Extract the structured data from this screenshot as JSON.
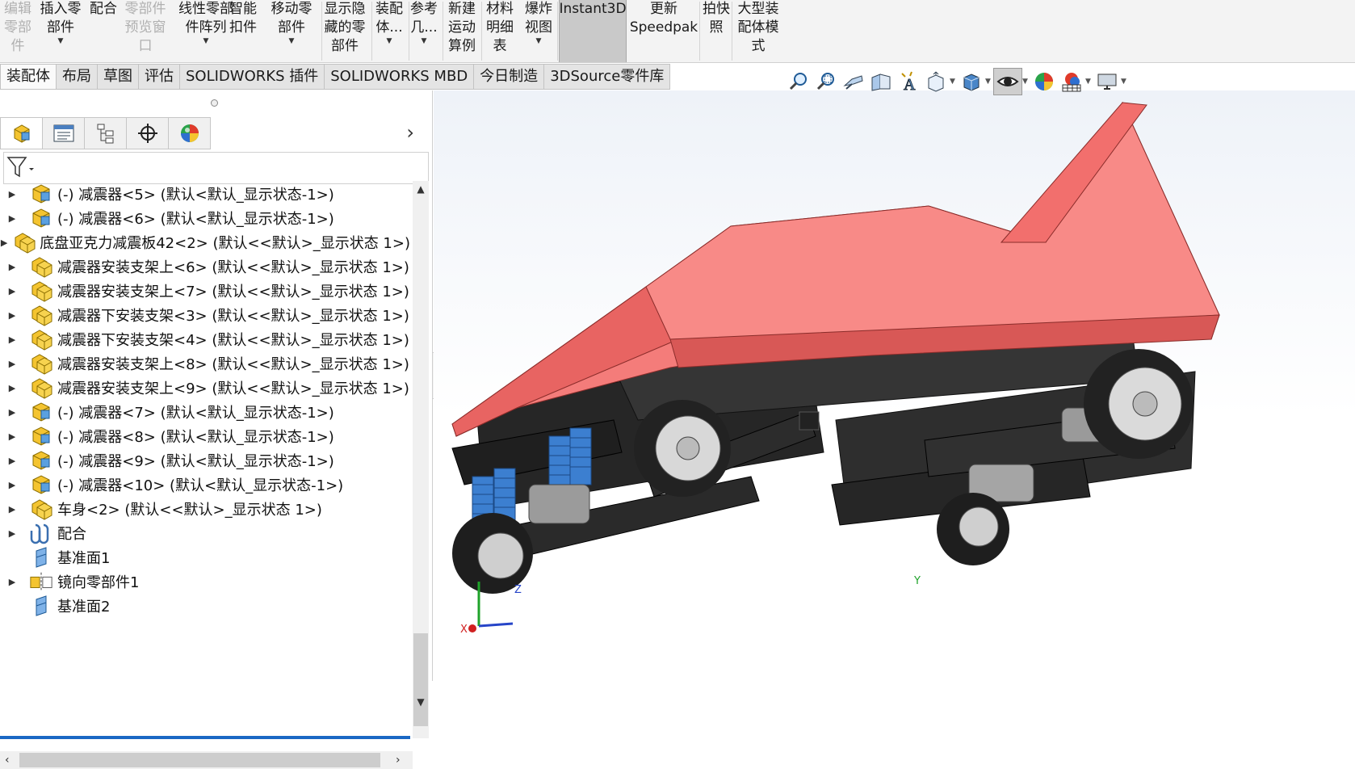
{
  "ribbon": {
    "buttons": [
      {
        "label": "编辑\n零部\n件",
        "disabled": true,
        "dropdown": false
      },
      {
        "label": "插入零\n部件",
        "disabled": false,
        "dropdown": true
      },
      {
        "label": "配合",
        "disabled": false,
        "dropdown": false
      },
      {
        "label": "零部件\n预览窗\n口",
        "disabled": true,
        "dropdown": false
      },
      {
        "label": "线性零部\n件阵列",
        "disabled": false,
        "dropdown": true
      },
      {
        "label": "智能\n扣件",
        "disabled": false,
        "dropdown": false
      },
      {
        "label": "移动零\n部件",
        "disabled": false,
        "dropdown": true
      },
      {
        "label": "显示隐\n藏的零\n部件",
        "disabled": false,
        "dropdown": false
      },
      {
        "label": "装配\n体...",
        "disabled": false,
        "dropdown": true
      },
      {
        "label": "参考\n几...",
        "disabled": false,
        "dropdown": true
      },
      {
        "label": "新建\n运动\n算例",
        "disabled": false,
        "dropdown": false
      },
      {
        "label": "材料\n明细\n表",
        "disabled": false,
        "dropdown": false
      },
      {
        "label": "爆炸\n视图",
        "disabled": false,
        "dropdown": true
      },
      {
        "label": "Instant3D",
        "disabled": false,
        "dropdown": false,
        "selected": true
      },
      {
        "label": "更新\nSpeedpak",
        "disabled": false,
        "dropdown": false
      },
      {
        "label": "拍快\n照",
        "disabled": false,
        "dropdown": false
      },
      {
        "label": "大型装\n配体模\n式",
        "disabled": false,
        "dropdown": false
      }
    ]
  },
  "tabs": [
    "装配体",
    "布局",
    "草图",
    "评估",
    "SOLIDWORKS 插件",
    "SOLIDWORKS MBD",
    "今日制造",
    "3DSource零件库"
  ],
  "active_tab": 0,
  "panel": {
    "tab_icons": [
      "assembly-tab-icon",
      "property-manager-icon",
      "configuration-manager-icon",
      "dimxpert-icon",
      "appearance-icon"
    ],
    "tree": [
      {
        "label": "(-) 减震器<5> (默认<默认_显示状态-1>)",
        "icon": "subassembly-icon",
        "expandable": true
      },
      {
        "label": "(-) 减震器<6> (默认<默认_显示状态-1>)",
        "icon": "subassembly-icon",
        "expandable": true
      },
      {
        "label": "底盘亚克力减震板42<2> (默认<<默认>_显示状态 1>)",
        "icon": "part-icon",
        "expandable": true
      },
      {
        "label": "减震器安装支架上<6> (默认<<默认>_显示状态 1>)",
        "icon": "part-icon",
        "expandable": true
      },
      {
        "label": "减震器安装支架上<7> (默认<<默认>_显示状态 1>)",
        "icon": "part-icon",
        "expandable": true
      },
      {
        "label": "减震器下安装支架<3> (默认<<默认>_显示状态 1>)",
        "icon": "part-icon",
        "expandable": true
      },
      {
        "label": "减震器下安装支架<4> (默认<<默认>_显示状态 1>)",
        "icon": "part-icon",
        "expandable": true
      },
      {
        "label": "减震器安装支架上<8> (默认<<默认>_显示状态 1>)",
        "icon": "part-icon",
        "expandable": true
      },
      {
        "label": "减震器安装支架上<9> (默认<<默认>_显示状态 1>)",
        "icon": "part-icon",
        "expandable": true
      },
      {
        "label": "(-) 减震器<7> (默认<默认_显示状态-1>)",
        "icon": "subassembly-icon",
        "expandable": true
      },
      {
        "label": "(-) 减震器<8> (默认<默认_显示状态-1>)",
        "icon": "subassembly-icon",
        "expandable": true
      },
      {
        "label": "(-) 减震器<9> (默认<默认_显示状态-1>)",
        "icon": "subassembly-icon",
        "expandable": true
      },
      {
        "label": "(-) 减震器<10> (默认<默认_显示状态-1>)",
        "icon": "subassembly-icon",
        "expandable": true
      },
      {
        "label": "车身<2> (默认<<默认>_显示状态 1>)",
        "icon": "part-icon",
        "expandable": true
      },
      {
        "label": "配合",
        "icon": "mates-icon",
        "expandable": true
      },
      {
        "label": "基准面1",
        "icon": "plane-icon",
        "expandable": false
      },
      {
        "label": "镜向零部件1",
        "icon": "mirror-component-icon",
        "expandable": true
      },
      {
        "label": "基准面2",
        "icon": "plane-icon",
        "expandable": false
      }
    ]
  },
  "heads_up_toolbar": [
    "zoom-to-fit-icon",
    "zoom-to-area-icon",
    "previous-view-icon",
    "section-view-icon",
    "dynamic-annotation-icon",
    "view-orientation-icon",
    "display-style-icon",
    "hide-show-items-icon",
    "edit-appearance-icon",
    "apply-scene-icon",
    "view-settings-icon"
  ],
  "triad": {
    "x_label": "X",
    "y_label": "Y",
    "z_label": "Z"
  },
  "colors": {
    "body_shell": "#f47c7a",
    "chassis": "#2b2b2b",
    "shock_spring": "#3c7fd0",
    "accent_blue": "#1a68c4"
  }
}
